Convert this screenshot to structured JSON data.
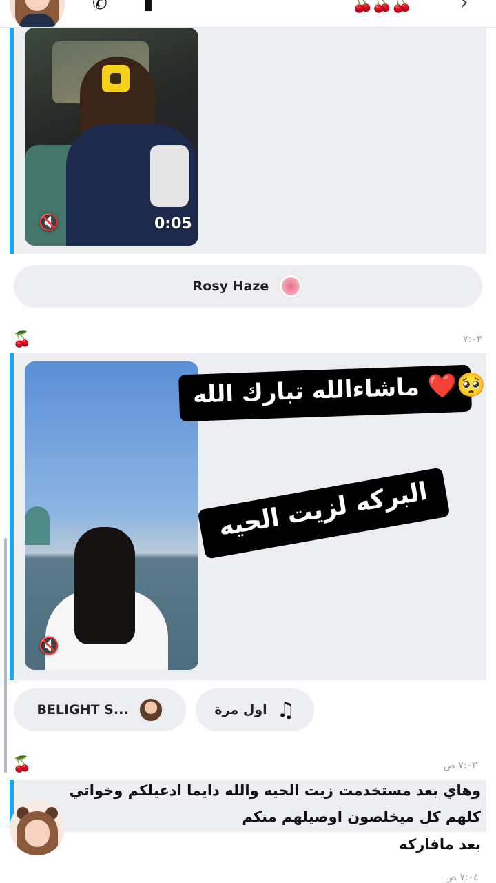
{
  "header": {
    "call_icon": "phone-icon",
    "video_icon": "video-camera-icon",
    "cherries_icon": "cherries-icon",
    "more_icon": "chevron-icon"
  },
  "messages": [
    {
      "type": "video_snap",
      "duration": "0:05",
      "muted": true,
      "sticker": "bitmoji-qr-sticker"
    },
    {
      "type": "sound_chip",
      "label": "Rosy Haze"
    },
    {
      "type": "video_snap",
      "timestamp": "٧:٠٣",
      "muted": true,
      "captions": [
        "ماشاءالله تبارك الله ❤️🥺",
        "البركه لزيت الحيه"
      ]
    },
    {
      "type": "chips",
      "music_label": "اول مرة",
      "creator_label": "BELIGHT S..."
    },
    {
      "type": "text",
      "timestamp": "٧:٠٣ ص",
      "lines": [
        "وهاي بعد مستخدمت زيت الحيه والله دايما ادعيلكم وخواتي",
        "كلهم كل ميخلصون اوصيلهم منكم",
        "بعد مافاركه"
      ]
    },
    {
      "type": "text",
      "timestamp": "٧:٠٤ ص"
    }
  ],
  "colors": {
    "accent_bar": "#19a7f0",
    "bubble_bg": "#eceef2",
    "cherry": "#c8102e"
  }
}
